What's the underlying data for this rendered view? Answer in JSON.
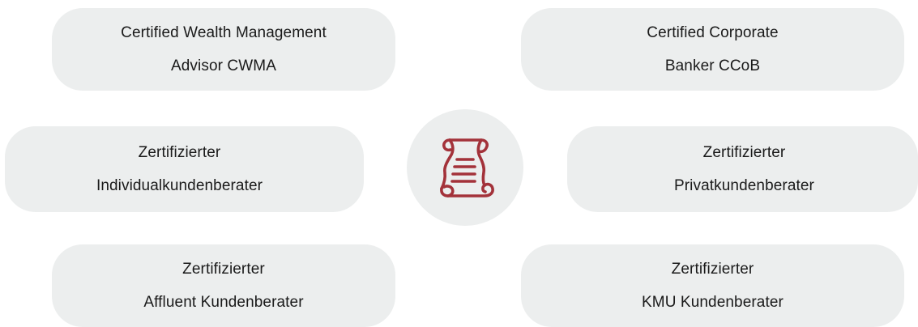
{
  "colors": {
    "card_background": "#eceeee",
    "text": "#1a1a1a",
    "icon_accent": "#a3323a"
  },
  "center": {
    "icon": "scroll-certificate-icon"
  },
  "cards": {
    "top_left": {
      "text": "Certified Wealth Management\nAdvisor CWMA"
    },
    "top_right": {
      "text": "Certified Corporate\nBanker CCoB"
    },
    "middle_left": {
      "text": "Zertifizierter\nIndividualkundenberater"
    },
    "middle_right": {
      "text": "Zertifizierter\nPrivatkundenberater"
    },
    "bottom_left": {
      "text": "Zertifizierter\nAffluent Kundenberater"
    },
    "bottom_right": {
      "text": "Zertifizierter\nKMU Kundenberater"
    }
  }
}
